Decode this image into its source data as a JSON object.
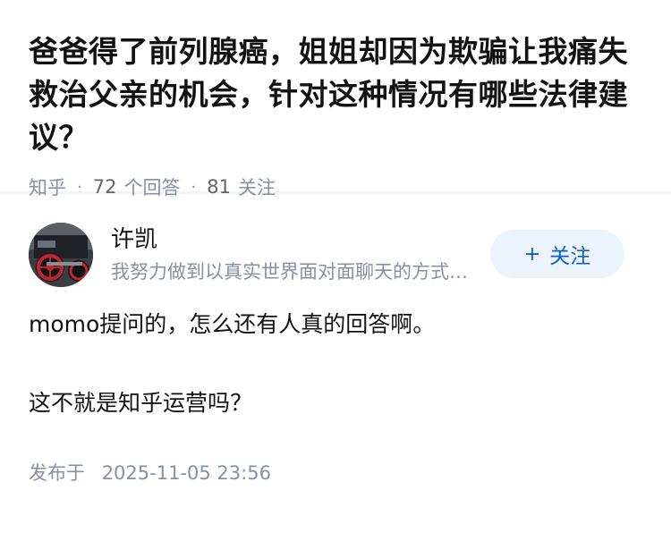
{
  "question": {
    "title": "爸爸得了前列腺癌，姐姐却因为欺骗让我痛失救治父亲的机会，针对这种情况有哪些法律建议？",
    "source": "知乎",
    "answer_count": "72",
    "answer_label": "个回答",
    "follow_count": "81",
    "follow_label": "关注"
  },
  "answer": {
    "author_name": "许凯",
    "author_bio": "我努力做到以真实世界面对面聊天的方式来讨论问题",
    "follow_button": "关注",
    "paragraphs": [
      "momo提问的，怎么还有人真的回答啊。",
      "这不就是知乎运营吗？"
    ],
    "published_label": "发布于",
    "published_time": "2025-11-05 23:56"
  },
  "colors": {
    "meta_gray": "#8590a6",
    "brand_blue": "#0d5fd0",
    "button_bg": "#ebf3fd"
  },
  "icons": {
    "avatar": "steam-locomotive-avatar",
    "follow": "plus-icon"
  }
}
